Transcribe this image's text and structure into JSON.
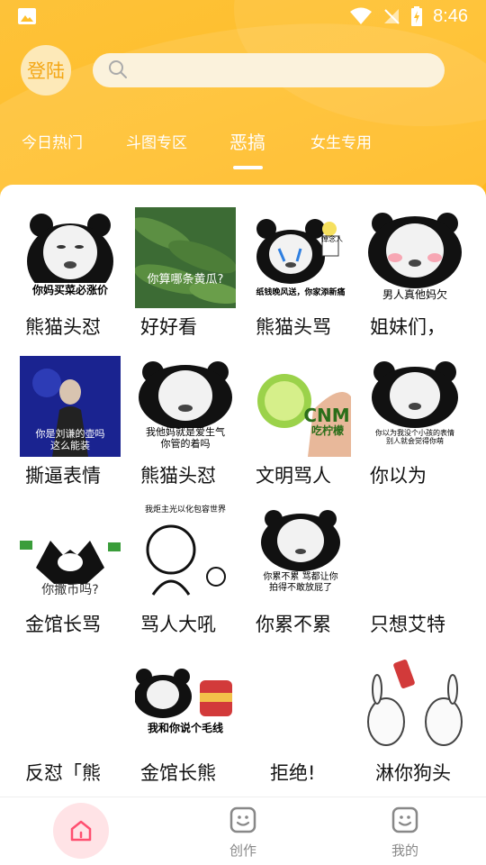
{
  "status": {
    "time": "8:46"
  },
  "header": {
    "login_label": "登陆",
    "search_placeholder": "",
    "tabs": [
      {
        "label": "今日热门",
        "active": false
      },
      {
        "label": "斗图专区",
        "active": false
      },
      {
        "label": "恶搞",
        "active": true
      },
      {
        "label": "女生专用",
        "active": false
      }
    ]
  },
  "grid": {
    "items": [
      {
        "caption": "熊猫头怼",
        "meme_text": "你妈买菜必涨价"
      },
      {
        "caption": "好好看",
        "meme_text": "你算哪条黄瓜?"
      },
      {
        "caption": "熊猫头骂",
        "meme_text": "纸钱晚风送，你家添新痛",
        "badge": "悼念人"
      },
      {
        "caption": "姐妹们，",
        "meme_text": "男人真他妈欠 "
      },
      {
        "caption": "撕逼表情",
        "meme_text": "你是刘谦的壶吗\n这么能装"
      },
      {
        "caption": "熊猫头怼",
        "meme_text": "我他妈就是爱生气\n你管的着吗"
      },
      {
        "caption": "文明骂人",
        "meme_text": "CNM",
        "meme_text2": "吃柠檬"
      },
      {
        "caption": "你以为",
        "meme_text": "你以为我没个小孩的表情\n别人就会觉得你萌"
      },
      {
        "caption": "金馆长骂",
        "meme_text": "你撒币吗?"
      },
      {
        "caption": "骂人大吼",
        "meme_text": "我炬主光以化包容世界"
      },
      {
        "caption": "你累不累",
        "meme_text": "你累不累 骂都让你\n拍得不敢放屁了"
      },
      {
        "caption": "只想艾特",
        "meme_text": ""
      },
      {
        "caption": "反怼「熊",
        "meme_text": ""
      },
      {
        "caption": "金馆长熊",
        "meme_text": "我和你说个毛线"
      },
      {
        "caption": "拒绝!",
        "meme_text": ""
      },
      {
        "caption": "淋你狗头",
        "meme_text": ""
      }
    ]
  },
  "bottom_nav": {
    "items": [
      {
        "label": "",
        "icon": "home-icon",
        "active": true
      },
      {
        "label": "创作",
        "icon": "smile-box-icon",
        "active": false
      },
      {
        "label": "我的",
        "icon": "smile-box-icon",
        "active": false
      }
    ]
  },
  "colors": {
    "accent": "#ffbf2a",
    "login_text": "#f4a715",
    "home_active": "#ff4f70"
  }
}
